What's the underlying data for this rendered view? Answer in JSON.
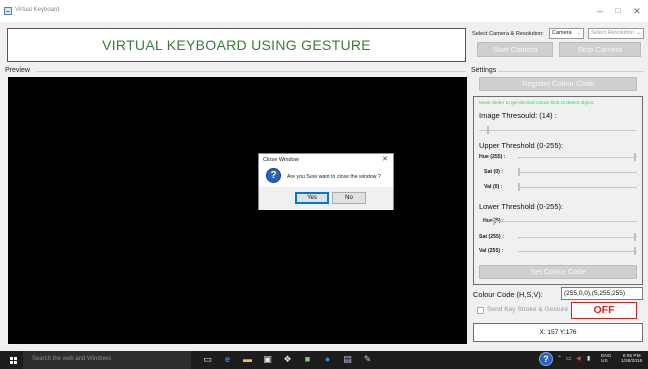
{
  "window": {
    "title": "Virtual Keyboard",
    "min_glyph": "–",
    "max_glyph": "□",
    "close_glyph": "✕"
  },
  "header": {
    "title": "VIRTUAL KEYBOARD USING GESTURE"
  },
  "camera": {
    "label": "Select Camera & Resolution:",
    "camera_select": "Camera",
    "resolution_select": "Select Resolution",
    "caret": "⌄",
    "start_button": "Start Camera",
    "stop_button": "Stop Camera"
  },
  "preview": {
    "label": "Preview"
  },
  "dialog": {
    "title": "Close Window",
    "close_glyph": "✕",
    "icon_glyph": "?",
    "message": "Are you Sure want to close the window ?",
    "yes": "Yes",
    "no": "No"
  },
  "settings": {
    "label": "Settings",
    "register_button": "Register Colour Code",
    "hint": "Move Slider to get desired colour blob to detect object.",
    "image_threshold": {
      "label": "Image Thresould: (14) :",
      "value": 14,
      "max": 255
    },
    "upper_threshold": {
      "label": "Upper Threshold (0-255):",
      "rows": [
        {
          "label": "Hue (255) :",
          "value": 255
        },
        {
          "label": "Sat (0) :",
          "value": 0
        },
        {
          "label": "Val (0) :",
          "value": 0
        }
      ]
    },
    "lower_threshold": {
      "label": "Lower Threshold (0-255):",
      "rows": [
        {
          "label": "Hue (5) :",
          "value": 5
        },
        {
          "label": "Sat (255) :",
          "value": 255
        },
        {
          "label": "Val (255) :",
          "value": 255
        }
      ]
    },
    "set_colour_button": "Set Colour Code",
    "colour_code_label": "Colour Code (H,S,V):",
    "colour_code_value": "(255,0,0),(5,255,255)",
    "send_key_label": "Send Key Stroke & Gesture",
    "send_key_checked": false,
    "status": "OFF",
    "coords": "X: 157 Y:176"
  },
  "taskbar": {
    "search_placeholder": "Search the web and Windows",
    "tray_question": "?",
    "tray_lang_1": "ENG",
    "tray_lang_2": "US",
    "time": "8:55 PM",
    "date": "1/28/2016"
  },
  "colors": {
    "title_green": "#3d7a3a",
    "hint_green": "#2ee52e",
    "status_red": "#e02020",
    "preview_bg": "#000000",
    "taskbar_bg": "#1d1d1d",
    "disabled_button": "#cfcfcf"
  }
}
